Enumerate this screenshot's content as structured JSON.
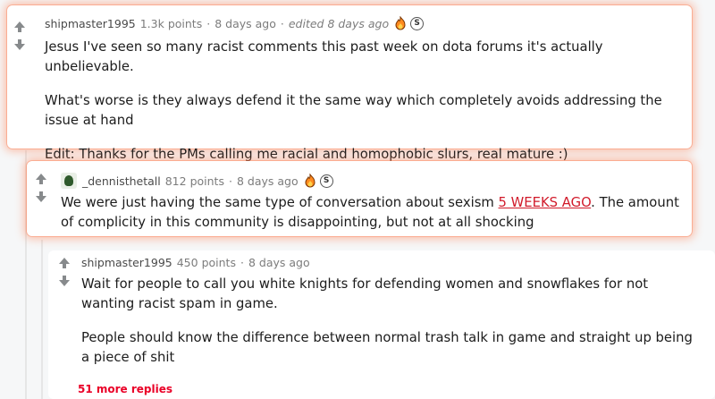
{
  "comments": [
    {
      "username": "shipmaster1995",
      "points": "1.3k points",
      "time": "8 days ago",
      "edited": "edited 8 days ago",
      "paragraphs": [
        "Jesus I've seen so many racist comments this past week on dota forums it's actually unbelievable.",
        "What's worse is they always defend it the same way which completely avoids addressing the issue at hand",
        "Edit: Thanks for the PMs calling me racial and homophobic slurs, real mature :)"
      ],
      "awards": [
        "fire-award",
        "silver-award"
      ]
    },
    {
      "username": "_dennisthetall",
      "points": "812 points",
      "time": "8 days ago",
      "text_before_link": "We were just having the same type of conversation about sexism ",
      "link_text": "5 WEEKS AGO",
      "text_after_link": ". The amount of complicity in this community is disappointing, but not at all shocking",
      "awards": [
        "fire-award",
        "silver-award"
      ]
    },
    {
      "username": "shipmaster1995",
      "points": "450 points",
      "time": "8 days ago",
      "paragraphs": [
        "Wait for people to call you white knights for defending women and snowflakes for not wanting racist spam in game.",
        "People should know the difference between normal trash talk in game and straight up being a piece of shit"
      ]
    }
  ],
  "more_replies": "51 more replies",
  "colors": {
    "accent_glow": "#ff7846",
    "link": "#d11a2a",
    "more": "#ea0027"
  }
}
